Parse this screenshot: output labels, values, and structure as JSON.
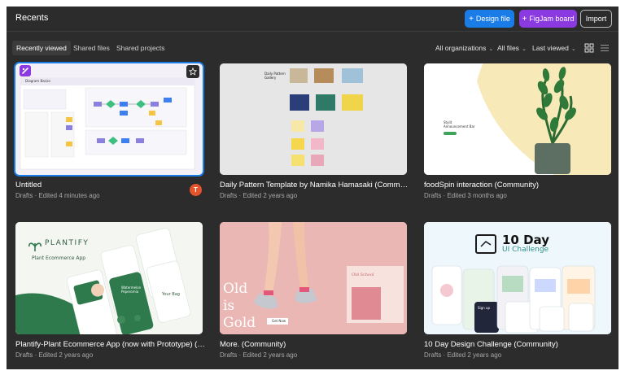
{
  "header": {
    "title": "Recents",
    "design_file_label": "Design file",
    "figjam_board_label": "FigJam board",
    "import_label": "Import"
  },
  "toolbar": {
    "tabs": [
      "Recently viewed",
      "Shared files",
      "Shared projects"
    ],
    "filters": {
      "organizations": "All organizations",
      "files": "All files",
      "sort": "Last viewed"
    },
    "view_mode": "grid"
  },
  "files": [
    {
      "title": "Untitled",
      "meta": "Drafts · Edited 4 minutes ago",
      "avatar": "T",
      "thumb_heading": "Diagram Basics"
    },
    {
      "title": "Daily Pattern Template by Namika Hamasaki (Community)",
      "meta": "Drafts · Edited 2 years ago",
      "thumb_heading": "Daily Pattern Gallery"
    },
    {
      "title": "foodSpin interaction (Community)",
      "meta": "Drafts · Edited 3 months ago",
      "thumb_heading": "Stylit Announcement Bar"
    },
    {
      "title": "Plantify-Plant Ecommerce App (now with Prototype) (Community)",
      "meta": "Drafts · Edited 2 years ago",
      "thumb_brand": "PLANTIFY",
      "thumb_subtitle": "Plant Ecommerce App",
      "thumb_card_text": "Watermelon Peperomia",
      "thumb_card_text2": "Your Bag"
    },
    {
      "title": "More. (Community)",
      "meta": "Drafts · Edited 2 years ago",
      "thumb_big_text": [
        "Old",
        "is",
        "Gold"
      ],
      "thumb_panel_title": "Old School",
      "thumb_button": "Get Now"
    },
    {
      "title": "10 Day Design Challenge (Community)",
      "meta": "Drafts · Edited 2 years ago",
      "thumb_heading": "10 Day",
      "thumb_subheading": "UI Challenge",
      "thumb_card_text": "Sign up"
    }
  ],
  "colors": {
    "background": "#2c2c2c",
    "design_button": "#1a7ce6",
    "figjam_button": "#8a3ae0",
    "avatar": "#e5542b"
  }
}
